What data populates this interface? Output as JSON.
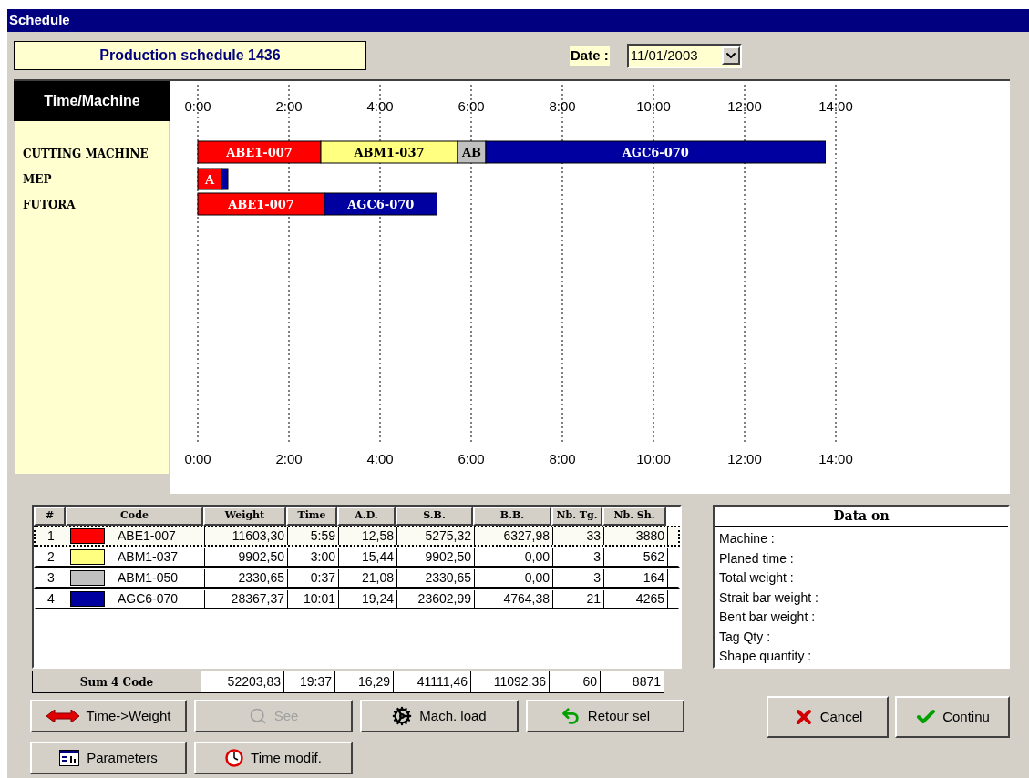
{
  "window": {
    "title": "Schedule"
  },
  "header": {
    "title": "Production schedule 1436",
    "date_label": "Date :",
    "date_value": "11/01/2003"
  },
  "schedule": {
    "corner_label": "Time/Machine",
    "chart_data": {
      "type": "bar",
      "orientation": "horizontal",
      "stacked": true,
      "grid": true,
      "xlim": [
        0,
        14
      ],
      "categories": [
        "CUTTING MACHINE",
        "MEP",
        "FUTORA"
      ],
      "xticks": [
        {
          "value": 0,
          "label": "0:00"
        },
        {
          "value": 2,
          "label": "2:00"
        },
        {
          "value": 4,
          "label": "4:00"
        },
        {
          "value": 6,
          "label": "6:00"
        },
        {
          "value": 8,
          "label": "8:00"
        },
        {
          "value": 10,
          "label": "10:00"
        },
        {
          "value": 12,
          "label": "12:00"
        },
        {
          "value": 14,
          "label": "14:00"
        }
      ],
      "series": [
        {
          "name": "ABE1-007",
          "color": "#ff0000",
          "values": [
            2.7,
            0.52,
            2.78
          ]
        },
        {
          "name": "ABM1-037",
          "color": "#ffff80",
          "values": [
            3.0,
            0,
            0
          ]
        },
        {
          "name": "AB",
          "color": "#c0c0c0",
          "values": [
            0.62,
            0,
            0
          ]
        },
        {
          "name": "AGC6-070",
          "color": "#0000a0",
          "values": [
            7.45,
            0.14,
            2.47
          ]
        }
      ],
      "annotations": [
        "A",
        "ABE1-007",
        "AGC6-070"
      ]
    }
  },
  "table": {
    "columns": [
      "#",
      "Code",
      "Weight",
      "Time",
      "A.D.",
      "S.B.",
      "B.B.",
      "Nb. Tg.",
      "Nb. Sh."
    ],
    "rows": [
      {
        "selected": true,
        "color": "#ff0000",
        "cells": [
          "1",
          "ABE1-007",
          "11603,30",
          "5:59",
          "12,58",
          "5275,32",
          "6327,98",
          "33",
          "3880"
        ]
      },
      {
        "selected": false,
        "color": "#ffff80",
        "cells": [
          "2",
          "ABM1-037",
          "9902,50",
          "3:00",
          "15,44",
          "9902,50",
          "0,00",
          "3",
          "562"
        ]
      },
      {
        "selected": false,
        "color": "#c0c0c0",
        "cells": [
          "3",
          "ABM1-050",
          "2330,65",
          "0:37",
          "21,08",
          "2330,65",
          "0,00",
          "3",
          "164"
        ]
      },
      {
        "selected": false,
        "color": "#0000a0",
        "cells": [
          "4",
          "AGC6-070",
          "28367,37",
          "10:01",
          "19,24",
          "23602,99",
          "4764,38",
          "21",
          "4265"
        ]
      }
    ],
    "totals": {
      "label": "Sum 4 Code",
      "cells": [
        "52203,83",
        "19:37",
        "16,29",
        "41111,46",
        "11092,36",
        "60",
        "8871"
      ]
    }
  },
  "data_on": {
    "title": "Data on",
    "fields": [
      "Machine :",
      "Planed time :",
      "Total weight :",
      "Strait bar weight :",
      "Bent bar weight :",
      "Tag Qty :",
      "Shape quantity :"
    ]
  },
  "buttons": [
    {
      "label": "Time->Weight",
      "disabled": false
    },
    {
      "label": "See",
      "disabled": true
    },
    {
      "label": "Mach. load",
      "disabled": false
    },
    {
      "label": "Retour sel",
      "disabled": false
    },
    {
      "label": "Parameters",
      "disabled": false
    },
    {
      "label": "Time modif.",
      "disabled": false
    }
  ],
  "dialog_buttons": [
    {
      "label": "Cancel"
    },
    {
      "label": "Continu"
    }
  ]
}
